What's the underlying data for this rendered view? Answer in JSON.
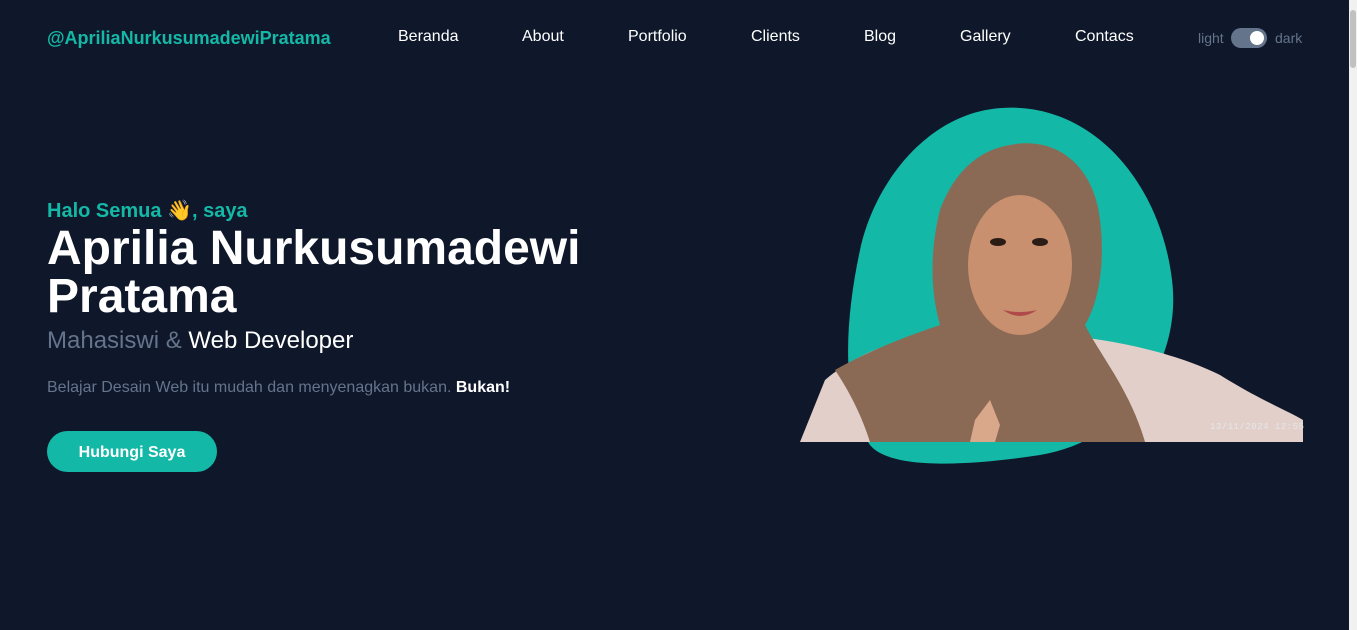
{
  "header": {
    "logo": "@ApriliaNurkusumadewiPratama",
    "nav": [
      "Beranda",
      "About",
      "Portfolio",
      "Clients",
      "Blog",
      "Gallery",
      "Contacs"
    ],
    "theme_toggle": {
      "light_label": "light",
      "dark_label": "dark",
      "state": "dark"
    }
  },
  "hero": {
    "greeting": "Halo Semua",
    "greeting_emoji": "👋",
    "greeting_suffix": ", saya",
    "name": "Aprilia Nurkusumadewi Pratama",
    "role_muted": "Mahasiswi &",
    "role_strong": "Web Developer",
    "tagline": "Belajar Desain Web itu mudah dan menyenagkan bukan.",
    "tagline_bold": "Bukan!",
    "cta_label": "Hubungi Saya",
    "photo_timestamp": "13/11/2024 12:55"
  },
  "colors": {
    "background": "#0f172a",
    "accent": "#14b8a6",
    "muted": "#64748b",
    "text": "#ffffff"
  }
}
